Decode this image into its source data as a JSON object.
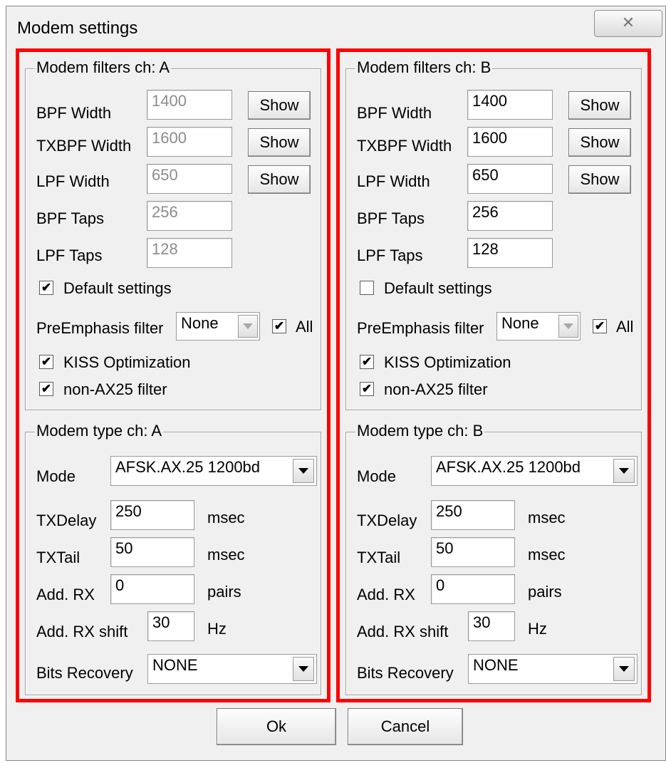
{
  "window": {
    "title": "Modem settings",
    "close_glyph": "✕"
  },
  "channels": [
    {
      "filters_legend": "Modem filters ch: A",
      "bpf_width": "1400",
      "txbpf_width": "1600",
      "lpf_width": "650",
      "bpf_taps": "256",
      "lpf_taps": "128",
      "default_settings_checked": true,
      "preemphasis_value": "None",
      "all_checked": true,
      "kiss_checked": true,
      "nonax25_checked": true,
      "type_legend": "Modem type ch: A",
      "mode": "AFSK.AX.25 1200bd",
      "txdelay": "250",
      "txtail": "50",
      "add_rx": "0",
      "add_rx_shift": "30",
      "bits_recovery": "NONE"
    },
    {
      "filters_legend": "Modem filters ch: B",
      "bpf_width": "1400",
      "txbpf_width": "1600",
      "lpf_width": "650",
      "bpf_taps": "256",
      "lpf_taps": "128",
      "default_settings_checked": false,
      "preemphasis_value": "None",
      "all_checked": true,
      "kiss_checked": true,
      "nonax25_checked": true,
      "type_legend": "Modem type ch: B",
      "mode": "AFSK.AX.25 1200bd",
      "txdelay": "250",
      "txtail": "50",
      "add_rx": "0",
      "add_rx_shift": "30",
      "bits_recovery": "NONE"
    }
  ],
  "labels": {
    "bpf_width": "BPF Width",
    "txbpf_width": "TXBPF Width",
    "lpf_width": "LPF Width",
    "bpf_taps": "BPF Taps",
    "lpf_taps": "LPF Taps",
    "show": "Show",
    "default_settings": "Default settings",
    "preemphasis": "PreEmphasis filter",
    "all": "All",
    "kiss": "KISS Optimization",
    "nonax25": "non-AX25 filter",
    "mode": "Mode",
    "txdelay": "TXDelay",
    "txtail": "TXTail",
    "add_rx": "Add. RX",
    "add_rx_shift": "Add. RX shift",
    "bits_recovery": "Bits Recovery",
    "msec": "msec",
    "pairs": "pairs",
    "hz": "Hz"
  },
  "buttons": {
    "ok": "Ok",
    "cancel": "Cancel"
  },
  "colors": {
    "highlight": "#ff0000",
    "face": "#f0f0f0"
  }
}
